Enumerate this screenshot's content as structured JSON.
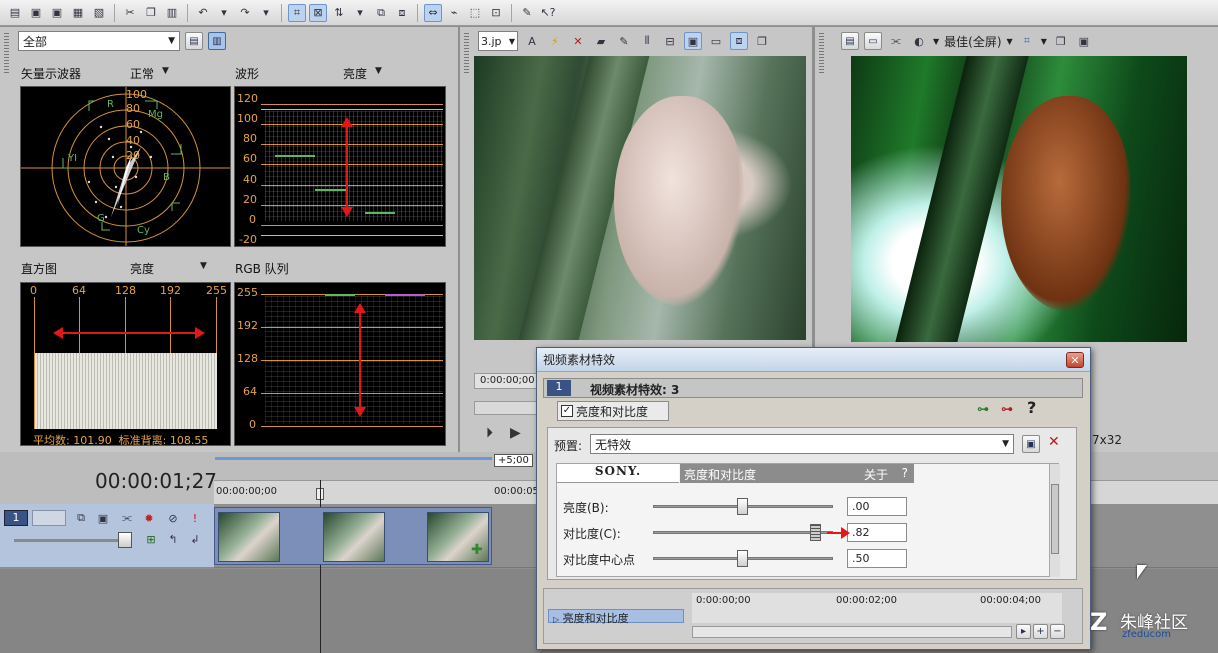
{
  "toolbar": {
    "icons": [
      "open-icon",
      "save-icon",
      "save-as-icon",
      "render-icon",
      "properties-icon",
      "cut-icon",
      "copy-icon",
      "paste-icon",
      "undo-icon",
      "redo-icon",
      "snap-icon",
      "auto-ripple-icon",
      "lock-envelope-icon",
      "post-edit-icon",
      "normal-edit-tool-icon",
      "envelope-tool-icon",
      "selection-tool-icon",
      "zoom-tool-icon",
      "paint-icon",
      "help-icon"
    ]
  },
  "scopes": {
    "combo_value": "全部",
    "vector": {
      "label": "矢量示波器",
      "mode": "正常",
      "ring_labels": [
        "100",
        "80",
        "60",
        "40",
        "20"
      ],
      "color_labels": [
        "R",
        "Mg",
        "B",
        "Cy",
        "G",
        "YI"
      ]
    },
    "waveform": {
      "label": "波形",
      "mode": "亮度",
      "ticks": [
        "120",
        "100",
        "80",
        "60",
        "40",
        "20",
        "0",
        "-20"
      ]
    },
    "histogram": {
      "label": "直方图",
      "mode": "亮度",
      "ticks": [
        "0",
        "64",
        "128",
        "192",
        "255"
      ],
      "stats": "平均数: 101.90  标准背离: 108.55"
    },
    "rgb": {
      "label": "RGB 队列",
      "ticks": [
        "255",
        "192",
        "128",
        "64",
        "0"
      ]
    }
  },
  "trimmer": {
    "file_combo": "3.jp",
    "timecode": "0:00:00;00"
  },
  "preview": {
    "quality": "最佳(全屏)",
    "resolution": "7x32"
  },
  "timeline": {
    "timecode": "00:00:01;27",
    "ruler_start": "00:00:00;00",
    "ruler_next": "00:00:05",
    "offset_badge": "+5;00",
    "track_number": "1"
  },
  "dialog": {
    "title": "视频素材特效",
    "header_number": "1",
    "header_label": "视频素材特效: 3",
    "chain_fx": "亮度和对比度",
    "preset_label": "预置:",
    "preset_value": "无特效",
    "brand": "SONY.",
    "fx_name": "亮度和对比度",
    "about": "关于",
    "about_q": "?",
    "params": [
      {
        "label": "亮度(B):",
        "value": ".00",
        "level": 0.5
      },
      {
        "label": "对比度(C):",
        "value": ".82",
        "level": 0.91
      },
      {
        "label": "对比度中心点",
        "value": ".50",
        "level": 0.5
      }
    ],
    "keyframe_label": "亮度和对比度",
    "keyframe_ticks": [
      "0:00:00;00",
      "00:00:02;00",
      "00:00:04;00"
    ]
  },
  "watermark": {
    "text": "朱峰社区",
    "sub": "zfeducom"
  },
  "colors": {
    "scope_orange": "#e5a24a",
    "scope_green": "#5fb75f",
    "annotation_red": "#e01818",
    "clip_blue": "#7c8fb8"
  }
}
